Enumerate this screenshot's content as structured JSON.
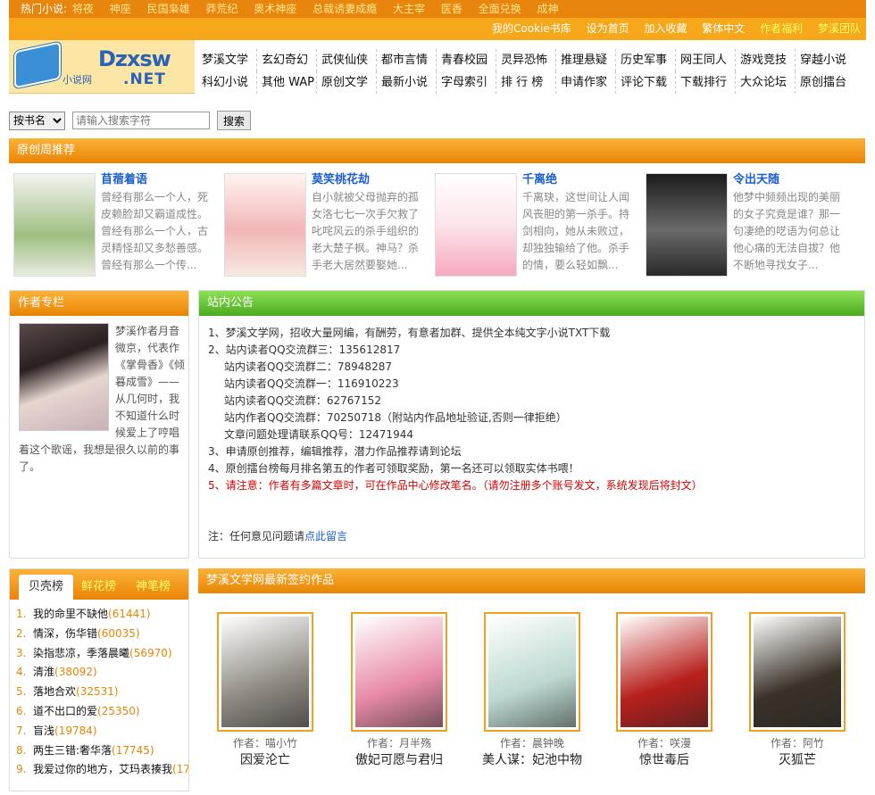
{
  "hot": {
    "label": "热门小说:",
    "items": [
      "将夜",
      "神座",
      "民国枭雄",
      "莽荒纪",
      "奥术神座",
      "总裁诱妻成瘾",
      "大主宰",
      "医香",
      "全面兑换",
      "成神"
    ]
  },
  "top_links": [
    "我的Cookie书库",
    "设为首页",
    "加入收藏",
    "繁体中文",
    "作者福利",
    "梦溪团队"
  ],
  "logo": {
    "main": "Dzxsw",
    "net": ".NET",
    "cn": "小说网"
  },
  "nav_row1": [
    "梦溪文学",
    "玄幻奇幻",
    "武侠仙侠",
    "都市言情",
    "青春校园",
    "灵异恐怖",
    "推理悬疑",
    "历史军事",
    "网王同人",
    "游戏竞技",
    "穿越小说"
  ],
  "nav_row2": [
    "科幻小说",
    "其他 WAP",
    "原创文学",
    "最新小说",
    "字母索引",
    "排 行 榜",
    "申请作家",
    "评论下载",
    "下载排行",
    "大众论坛",
    "原创擂台"
  ],
  "search": {
    "select_value": "按书名",
    "placeholder": "请输入搜索字符",
    "button": "搜索"
  },
  "recommend": {
    "title": "原创周推荐",
    "books": [
      {
        "title": "苜蓿着语",
        "desc": "曾经有那么一个人，死皮赖脸却又霸道成性。曾经有那么一个人，古灵精怪却又多愁善感。曾经有那么一个传..."
      },
      {
        "title": "莫笑桃花劫",
        "desc": "自小就被父母抛弃的孤女洛七七一次手欠救了叱咤风云的杀手组织的老大楚子枫。神马？杀手老大居然要娶她..."
      },
      {
        "title": "千离绝",
        "desc": "千离玦，这世间让人闻风丧胆的第一杀手。持剑相向，她从未败过，却独独输给了他。杀手的情，要么轻如飘..."
      },
      {
        "title": "令出天随",
        "desc": "他梦中频频出现的美丽的女子究竟是谁？那一句凄绝的呓语为何总让他心痛的无法自拔？他不断地寻找女子..."
      }
    ]
  },
  "author": {
    "title": "作者专栏",
    "text": "梦溪作者月音微京，代表作《掌骨香》《倾暮成雪》——从几何时，我不知道什么时候爱上了哼唱着这个歌谣，我想是很久以前的事了。"
  },
  "notice": {
    "title": "站内公告",
    "items": [
      {
        "text": "1、梦溪文学网，招收大量网编，有酬劳，有意者加群、提供全本纯文字小说TXT下载",
        "indent": false,
        "red": false
      },
      {
        "text": "2、站内读者QQ交流群三：135612817",
        "indent": false,
        "red": false
      },
      {
        "text": "站内读者QQ交流群二：78948287",
        "indent": true,
        "red": false
      },
      {
        "text": "站内读者QQ交流群一：116910223",
        "indent": true,
        "red": false
      },
      {
        "text": "站内读者QQ交流群：62767152",
        "indent": true,
        "red": false
      },
      {
        "text": "站内作者QQ交流群：70250718（附站内作品地址验证,否则一律拒绝）",
        "indent": true,
        "red": false
      },
      {
        "text": "文章问题处理请联系QQ号：12471944",
        "indent": true,
        "red": false
      },
      {
        "text": "3、申请原创推荐，编辑推荐，潜力作品推荐请到论坛",
        "indent": false,
        "red": false
      },
      {
        "text": "4、原创擂台榜每月排名第五的作者可领取奖励，第一名还可以领取实体书喂！",
        "indent": false,
        "red": false
      },
      {
        "text": "5、请注意：作者有多篇文章时，可在作品中心修改笔名。（请勿注册多个账号发文，系统发现后将封文）",
        "indent": false,
        "red": true
      }
    ],
    "note_prefix": "注：任何意见问题请",
    "note_link": "点此留言"
  },
  "rank": {
    "tabs": [
      "贝壳榜",
      "鲜花榜",
      "神笔榜"
    ],
    "items": [
      {
        "n": "1.",
        "title": "我的命里不缺他",
        "count": "(61441)"
      },
      {
        "n": "2.",
        "title": "情深，伤华错",
        "count": "(60035)"
      },
      {
        "n": "3.",
        "title": "染指悲凉，季落晨曦",
        "count": "(56970)"
      },
      {
        "n": "4.",
        "title": "清淮",
        "count": "(38092)"
      },
      {
        "n": "5.",
        "title": "落地合欢",
        "count": "(32531)"
      },
      {
        "n": "6.",
        "title": "道不出口的爱",
        "count": "(25350)"
      },
      {
        "n": "7.",
        "title": "盲浅",
        "count": "(19784)"
      },
      {
        "n": "8.",
        "title": "两生三错:奢华落",
        "count": "(17745)"
      },
      {
        "n": "9.",
        "title": "我爱过你的地方，艾玛表揍我",
        "count": "(17"
      }
    ]
  },
  "signed": {
    "title": "梦溪文学网最新签约作品",
    "books": [
      {
        "author": "作者：喵小竹",
        "title": "因爱沦亡",
        "color": "#8f8a82"
      },
      {
        "author": "作者：月半殇",
        "title": "傲妃可愿与君归",
        "color": "#e88ba8"
      },
      {
        "author": "作者：晨钟晚",
        "title": "美人谋：妃池中物",
        "color": "#bcd8d0"
      },
      {
        "author": "作者：咲漫",
        "title": "惊世毒后",
        "color": "#b8201c"
      },
      {
        "author": "作者：阿竹",
        "title": "灭狐芒",
        "color": "#3a3228"
      }
    ]
  }
}
